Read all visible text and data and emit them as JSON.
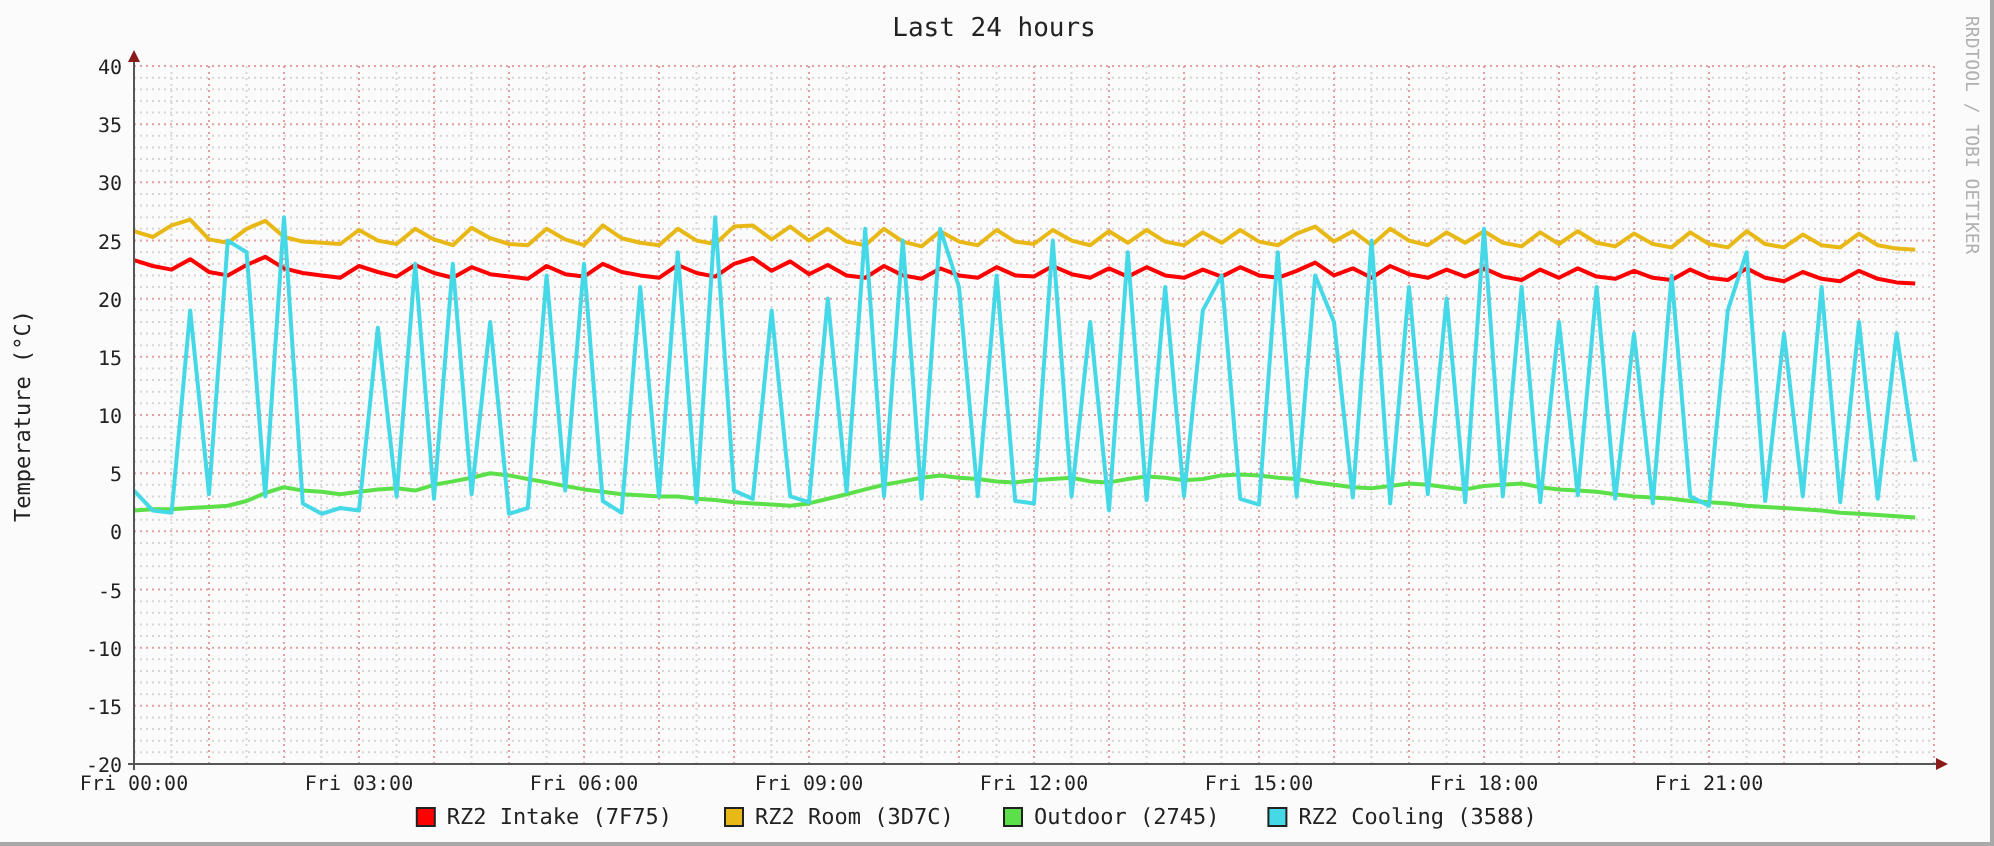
{
  "graph": {
    "credit": "RRDTOOL / TOBI OETIKER",
    "chart_data": {
      "type": "line",
      "grid": true,
      "legend": "bottom",
      "title": "Last 24 hours",
      "ylabel": "Temperature (°C)",
      "ylim": [
        -20,
        40
      ],
      "yticks": [
        -20,
        -15,
        -10,
        -5,
        0,
        5,
        10,
        15,
        20,
        25,
        30,
        35,
        40
      ],
      "categories": [
        "Fri 00:00",
        null,
        null,
        null,
        null,
        null,
        null,
        null,
        null,
        null,
        null,
        null,
        "Fri 03:00",
        null,
        null,
        null,
        null,
        null,
        null,
        null,
        null,
        null,
        null,
        null,
        "Fri 06:00",
        null,
        null,
        null,
        null,
        null,
        null,
        null,
        null,
        null,
        null,
        null,
        "Fri 09:00",
        null,
        null,
        null,
        null,
        null,
        null,
        null,
        null,
        null,
        null,
        null,
        "Fri 12:00",
        null,
        null,
        null,
        null,
        null,
        null,
        null,
        null,
        null,
        null,
        null,
        "Fri 15:00",
        null,
        null,
        null,
        null,
        null,
        null,
        null,
        null,
        null,
        null,
        null,
        "Fri 18:00",
        null,
        null,
        null,
        null,
        null,
        null,
        null,
        null,
        null,
        null,
        null,
        "Fri 21:00",
        null,
        null,
        null,
        null,
        null,
        null,
        null,
        null,
        null,
        null,
        null
      ],
      "series": [
        {
          "name": "RZ2 Intake (7F75)",
          "color": "#ff0000",
          "values": [
            23.3,
            22.8,
            22.5,
            23.4,
            22.3,
            22.0,
            22.9,
            23.6,
            22.6,
            22.2,
            22.0,
            21.8,
            22.8,
            22.3,
            21.9,
            22.9,
            22.2,
            21.8,
            22.7,
            22.1,
            21.9,
            21.7,
            22.8,
            22.1,
            21.9,
            23.0,
            22.3,
            22.0,
            21.8,
            22.9,
            22.2,
            21.9,
            23.0,
            23.5,
            22.4,
            23.2,
            22.1,
            22.9,
            22.0,
            21.8,
            22.8,
            22.0,
            21.7,
            22.6,
            22.0,
            21.8,
            22.7,
            22.0,
            21.9,
            22.8,
            22.1,
            21.8,
            22.6,
            21.9,
            22.7,
            22.0,
            21.8,
            22.5,
            21.9,
            22.7,
            22.0,
            21.8,
            22.4,
            23.1,
            22.0,
            22.6,
            21.8,
            22.8,
            22.1,
            21.8,
            22.5,
            21.9,
            22.6,
            21.9,
            21.6,
            22.5,
            21.8,
            22.6,
            21.9,
            21.7,
            22.4,
            21.8,
            21.6,
            22.5,
            21.8,
            21.6,
            22.6,
            21.8,
            21.5,
            22.3,
            21.7,
            21.5,
            22.4,
            21.7,
            21.4,
            21.3
          ]
        },
        {
          "name": "RZ2 Room (3D7C)",
          "color": "#e8b817",
          "values": [
            25.8,
            25.3,
            26.3,
            26.8,
            25.1,
            24.8,
            26.0,
            26.7,
            25.3,
            24.9,
            24.8,
            24.7,
            25.9,
            25.0,
            24.7,
            26.0,
            25.1,
            24.6,
            26.1,
            25.2,
            24.7,
            24.6,
            26.0,
            25.1,
            24.6,
            26.3,
            25.2,
            24.8,
            24.6,
            26.0,
            25.0,
            24.7,
            26.2,
            26.3,
            25.1,
            26.2,
            25.0,
            26.0,
            24.9,
            24.6,
            26.0,
            24.9,
            24.5,
            25.8,
            24.9,
            24.6,
            25.9,
            24.9,
            24.7,
            25.9,
            25.0,
            24.6,
            25.8,
            24.8,
            25.9,
            24.9,
            24.6,
            25.7,
            24.8,
            25.9,
            24.9,
            24.6,
            25.6,
            26.2,
            24.9,
            25.8,
            24.6,
            26.0,
            25.0,
            24.6,
            25.7,
            24.8,
            25.8,
            24.8,
            24.5,
            25.7,
            24.7,
            25.8,
            24.8,
            24.5,
            25.6,
            24.7,
            24.4,
            25.7,
            24.7,
            24.4,
            25.8,
            24.7,
            24.4,
            25.5,
            24.6,
            24.4,
            25.6,
            24.6,
            24.3,
            24.2
          ]
        },
        {
          "name": "Outdoor (2745)",
          "color": "#5ce04a",
          "values": [
            1.8,
            1.9,
            1.9,
            2.0,
            2.1,
            2.2,
            2.6,
            3.3,
            3.8,
            3.5,
            3.4,
            3.2,
            3.4,
            3.6,
            3.7,
            3.5,
            4.0,
            4.3,
            4.6,
            5.0,
            4.8,
            4.5,
            4.2,
            3.9,
            3.6,
            3.4,
            3.2,
            3.1,
            3.0,
            3.0,
            2.8,
            2.7,
            2.5,
            2.4,
            2.3,
            2.2,
            2.4,
            2.8,
            3.2,
            3.6,
            4.0,
            4.3,
            4.6,
            4.8,
            4.6,
            4.5,
            4.3,
            4.2,
            4.4,
            4.5,
            4.6,
            4.3,
            4.2,
            4.5,
            4.7,
            4.6,
            4.4,
            4.5,
            4.8,
            4.9,
            4.8,
            4.6,
            4.5,
            4.2,
            4.0,
            3.8,
            3.7,
            3.9,
            4.1,
            4.0,
            3.8,
            3.6,
            3.9,
            4.0,
            4.1,
            3.8,
            3.6,
            3.5,
            3.4,
            3.2,
            3.0,
            2.9,
            2.8,
            2.6,
            2.5,
            2.4,
            2.2,
            2.1,
            2.0,
            1.9,
            1.8,
            1.6,
            1.5,
            1.4,
            1.3,
            1.2
          ]
        },
        {
          "name": "RZ2 Cooling (3588)",
          "color": "#45d9e8",
          "values": [
            3.5,
            1.8,
            1.6,
            19,
            3.2,
            25,
            24,
            3.0,
            27,
            2.4,
            1.5,
            2.0,
            1.8,
            17.5,
            3.0,
            23,
            2.8,
            23,
            3.2,
            18,
            1.5,
            2.0,
            22,
            3.5,
            23,
            2.6,
            1.6,
            21,
            3.0,
            24,
            2.5,
            27,
            3.5,
            2.8,
            19,
            3.0,
            2.5,
            20,
            3.4,
            26,
            3.0,
            25,
            2.8,
            26,
            21,
            3.0,
            22,
            2.6,
            2.4,
            25,
            3.0,
            18,
            1.8,
            24,
            2.7,
            21,
            3.0,
            19,
            22,
            2.8,
            2.3,
            24,
            3.0,
            22,
            18,
            2.9,
            25,
            2.4,
            21,
            3.2,
            20,
            2.5,
            26,
            3.0,
            21,
            2.5,
            18,
            3.1,
            21,
            2.8,
            17,
            2.4,
            22,
            3.0,
            2.2,
            19,
            24,
            2.6,
            17,
            3.0,
            21,
            2.5,
            18,
            2.8,
            17,
            6.0
          ]
        }
      ]
    }
  }
}
